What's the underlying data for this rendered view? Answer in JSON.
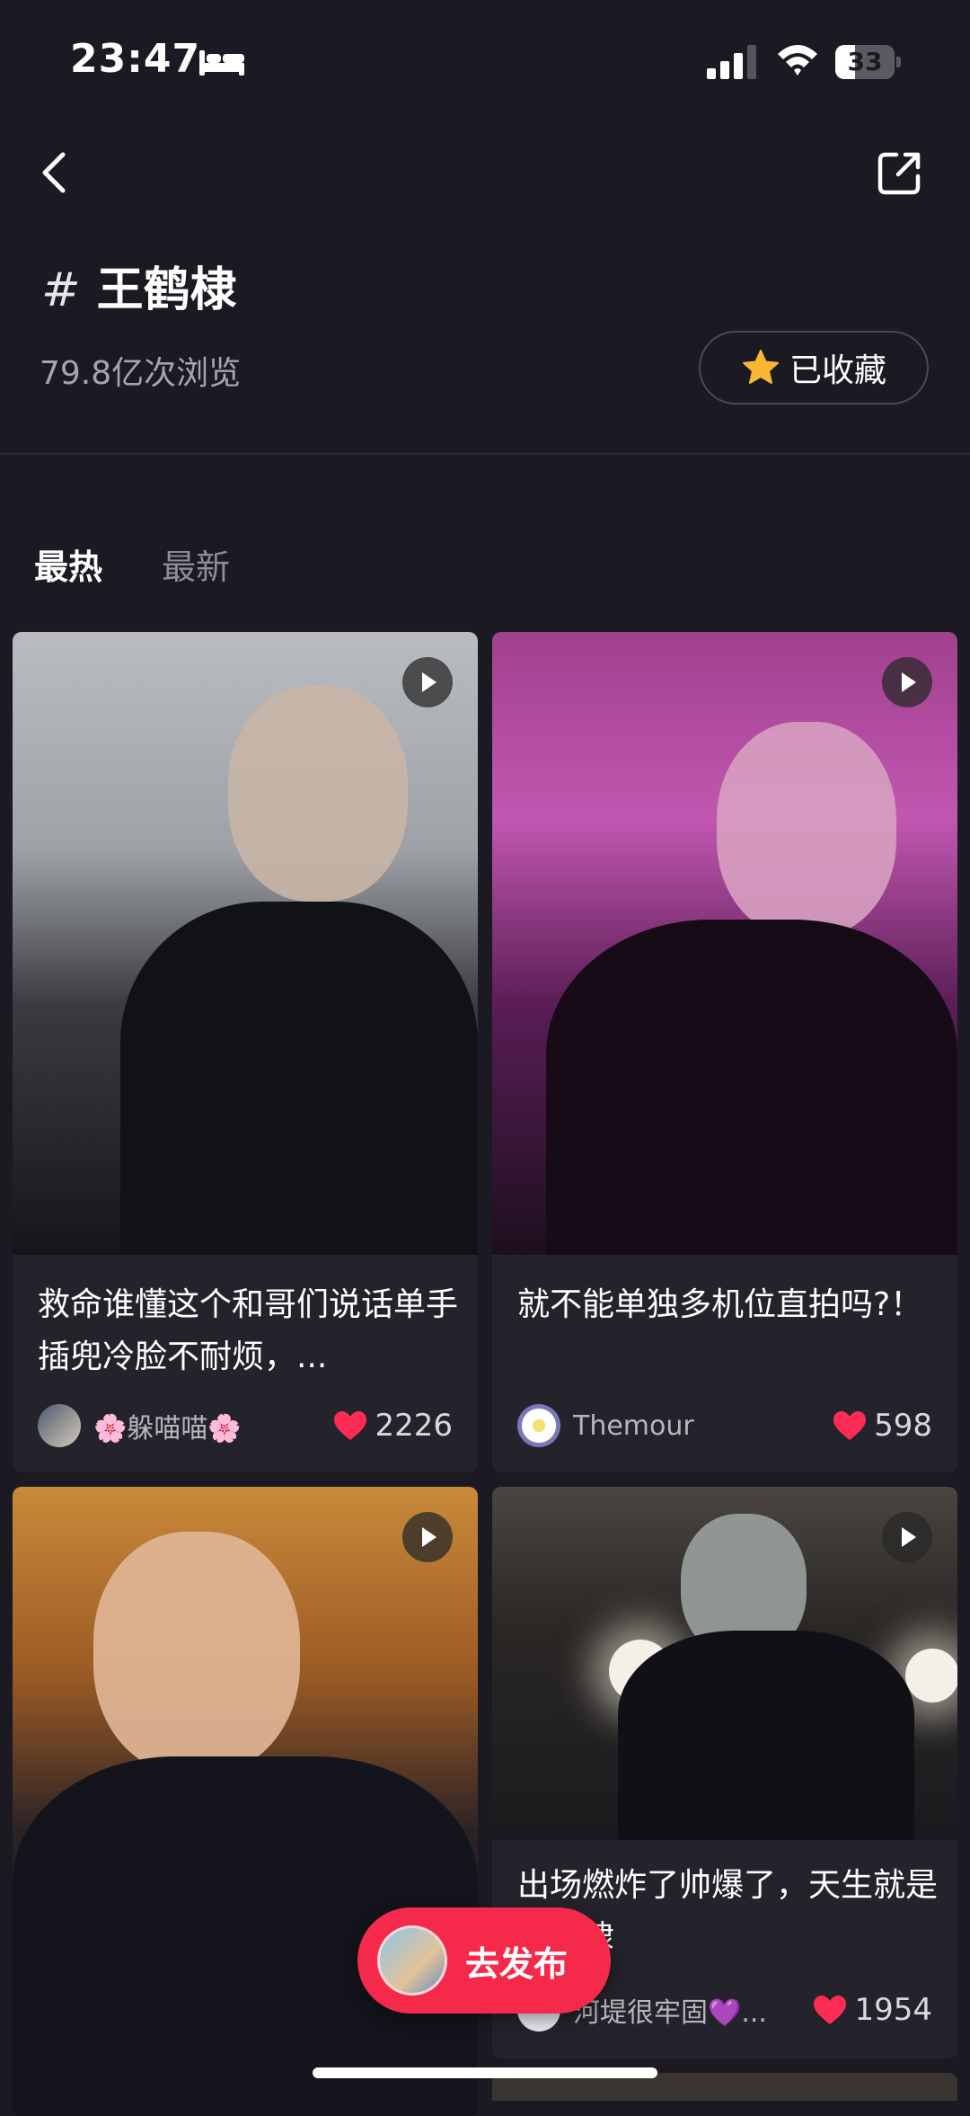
{
  "status_bar": {
    "time": "23:47",
    "battery": "33",
    "battery_level": 0.33
  },
  "header": {
    "title": "王鹤棣",
    "hash": "#",
    "views": "79.8亿次浏览",
    "favorite_label": "已收藏"
  },
  "tabs": [
    {
      "label": "最热",
      "active": true
    },
    {
      "label": "最新",
      "active": false
    }
  ],
  "cards": [
    {
      "title": "救命谁懂这个和哥们说话单手插兜冷脸不耐烦，...",
      "author": "🌸躲喵喵🌸",
      "likes": "2226",
      "is_video": true
    },
    {
      "title": "就不能单独多机位直拍吗?！",
      "author": "Themour",
      "likes": "598",
      "is_video": true
    },
    {
      "title": "",
      "author": "",
      "likes": "",
      "is_video": true
    },
    {
      "title": "出场燃炸了帅爆了，天生就是王鹤棣",
      "author": "河堤很牢固💜...",
      "likes": "1954",
      "is_video": true
    }
  ],
  "publish_button": {
    "label": "去发布"
  },
  "colors": {
    "background": "#1b1a22",
    "card": "#24232b",
    "accent": "#f5294a",
    "heart": "#fe2c55",
    "star": "#f7b731"
  }
}
